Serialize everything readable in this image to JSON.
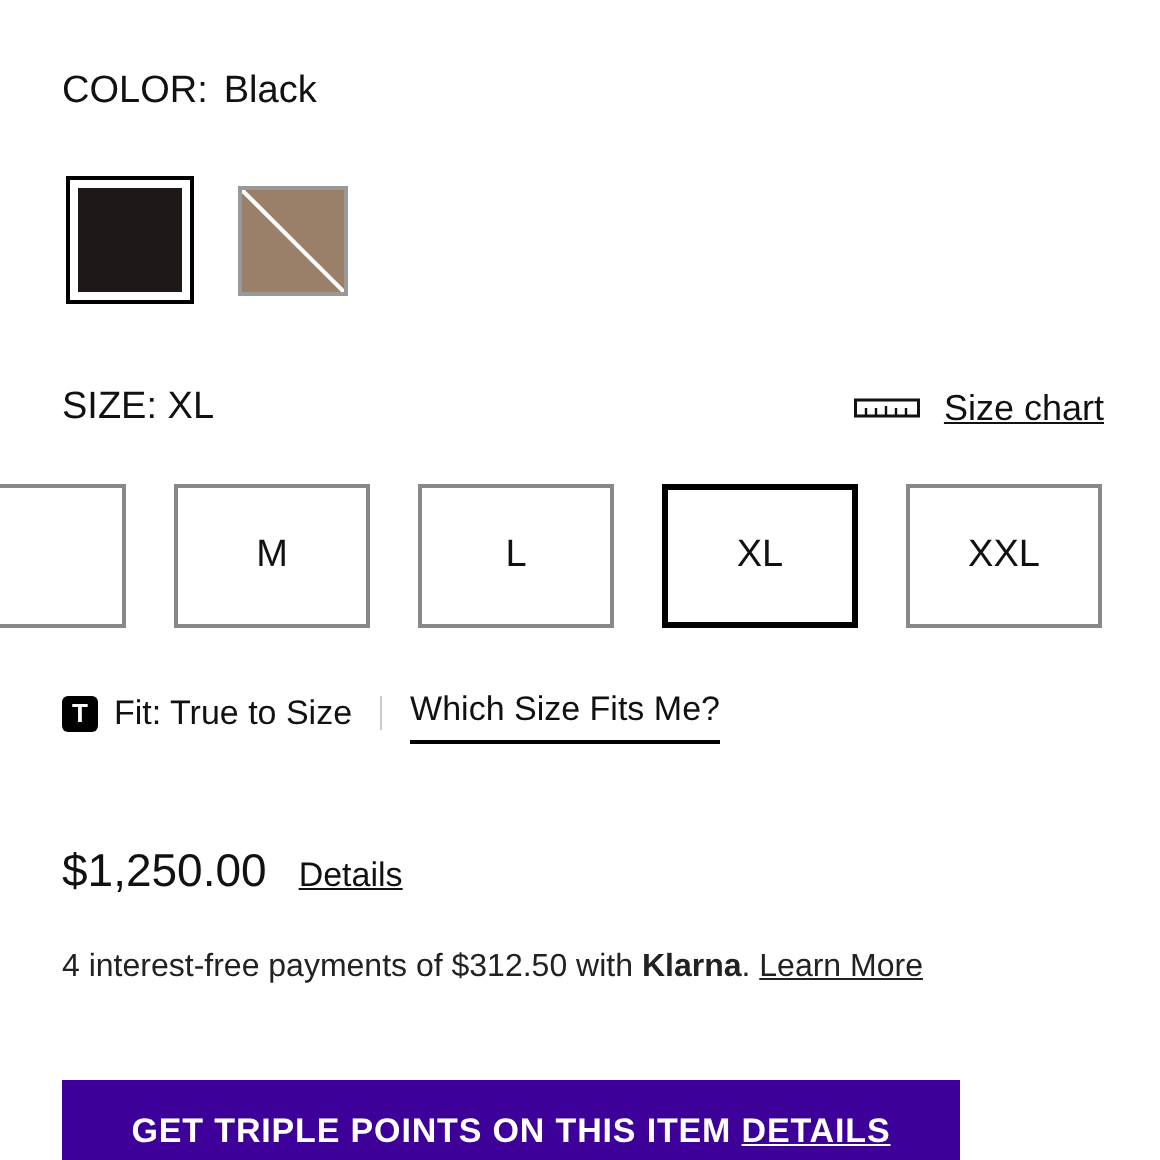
{
  "color": {
    "label": "COLOR:",
    "value": "Black",
    "swatches": [
      {
        "color": "#1e1816",
        "selected": true,
        "crossed": false
      },
      {
        "color": "#9a8068",
        "selected": false,
        "crossed": true
      }
    ]
  },
  "size": {
    "label": "SIZE: XL",
    "chart_link": "Size chart",
    "options": [
      {
        "label": "M",
        "selected": false
      },
      {
        "label": "L",
        "selected": false
      },
      {
        "label": "XL",
        "selected": true
      },
      {
        "label": "XXL",
        "selected": false
      }
    ],
    "fit_badge": "T",
    "fit_text": "Fit: True to Size",
    "fit_link": "Which Size Fits Me?"
  },
  "price": {
    "amount": "$1,250.00",
    "details_link": "Details",
    "installments": "4 interest-free payments of $312.50 with **Klarna**.",
    "learn_more": "Learn More"
  },
  "promo": {
    "text": "GET TRIPLE POINTS ON THIS ITEM",
    "link": "DETAILS"
  }
}
